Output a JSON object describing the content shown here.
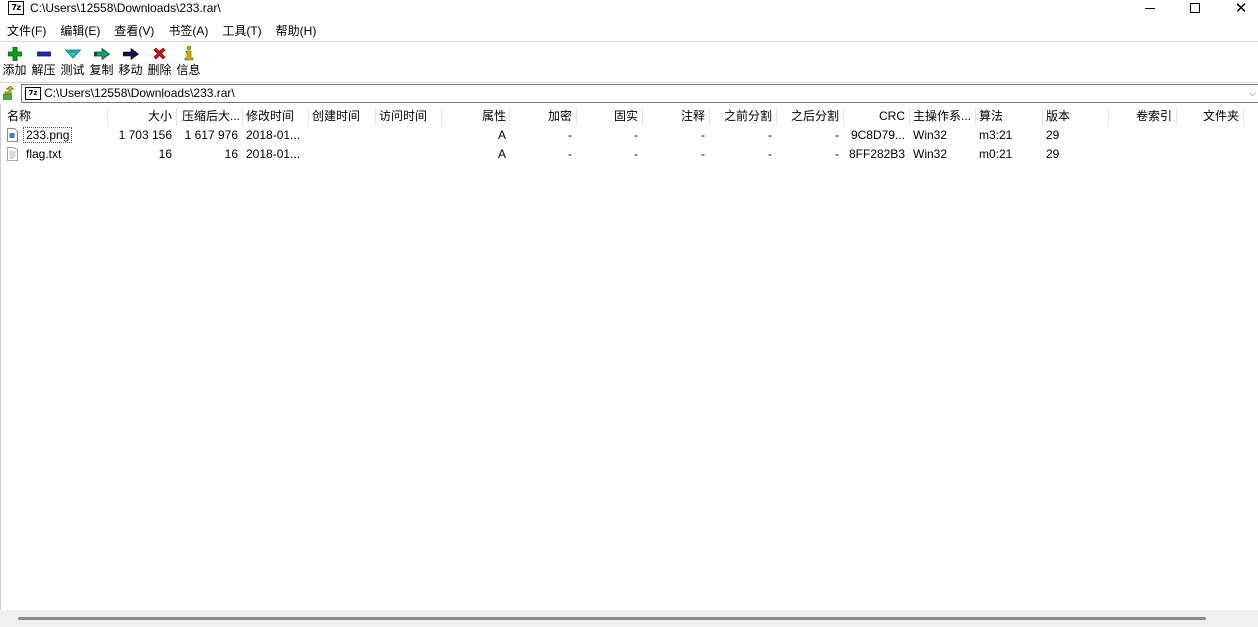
{
  "window": {
    "title": "C:\\Users\\12558\\Downloads\\233.rar\\",
    "app_icon_text": "7z"
  },
  "menu": [
    "文件(F)",
    "编辑(E)",
    "查看(V)",
    "书签(A)",
    "工具(T)",
    "帮助(H)"
  ],
  "toolbar": [
    {
      "label": "添加",
      "icon": "add-icon",
      "color": "#12a012"
    },
    {
      "label": "解压",
      "icon": "extract-icon",
      "color": "#1a2fb5"
    },
    {
      "label": "测试",
      "icon": "test-icon",
      "color": "#1aa8a8"
    },
    {
      "label": "复制",
      "icon": "copy-icon",
      "color": "#128a6a"
    },
    {
      "label": "移动",
      "icon": "move-icon",
      "color": "#10104f"
    },
    {
      "label": "删除",
      "icon": "delete-icon",
      "color": "#d01010"
    },
    {
      "label": "信息",
      "icon": "info-icon",
      "color": "#c8b400"
    }
  ],
  "address": {
    "path": "C:\\Users\\12558\\Downloads\\233.rar\\",
    "icon_text": "7z"
  },
  "columns": [
    "名称",
    "大小",
    "压缩后大...",
    "修改时间",
    "创建时间",
    "访问时间",
    "属性",
    "加密",
    "固实",
    "注释",
    "之前分割",
    "之后分割",
    "CRC",
    "主操作系...",
    "算法",
    "版本",
    "卷索引",
    "文件夹"
  ],
  "files": [
    {
      "name": "233.png",
      "size": "1 703 156",
      "packed": "1 617 976",
      "modified": "2018-01...",
      "created": "",
      "accessed": "",
      "attributes": "A",
      "encrypted": "-",
      "solid": "-",
      "comment": "-",
      "split_before": "-",
      "split_after": "-",
      "crc": "9C8D79...",
      "host_os": "Win32",
      "method": "m3:21",
      "version": "29",
      "volume": "",
      "folder": "",
      "icon": "image-file-icon"
    },
    {
      "name": "flag.txt",
      "size": "16",
      "packed": "16",
      "modified": "2018-01...",
      "created": "",
      "accessed": "",
      "attributes": "A",
      "encrypted": "-",
      "solid": "-",
      "comment": "-",
      "split_before": "-",
      "split_after": "-",
      "crc": "8FF282B3",
      "host_os": "Win32",
      "method": "m0:21",
      "version": "29",
      "volume": "",
      "folder": "",
      "icon": "text-file-icon"
    }
  ]
}
